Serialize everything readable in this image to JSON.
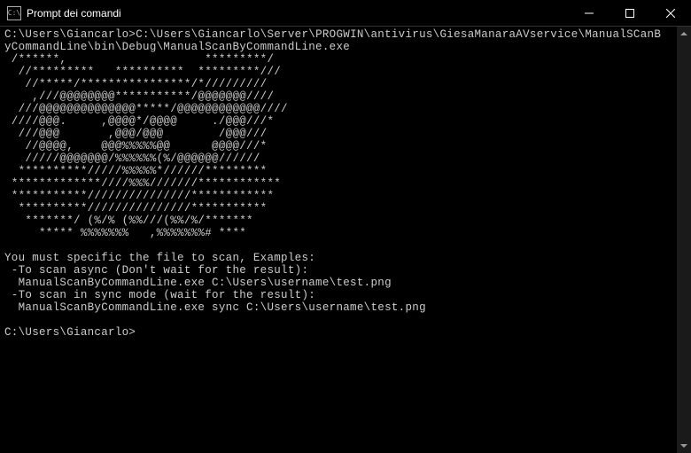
{
  "titlebar": {
    "icon_text": "C:\\",
    "title": "Prompt dei comandi"
  },
  "terminal": {
    "prompt1_path": "C:\\Users\\Giancarlo>",
    "command1": "C:\\Users\\Giancarlo\\Server\\PROGWIN\\antivirus\\GiesaManaraAVservice\\ManualSCanB",
    "command1_line2": "yCommandLine\\bin\\Debug\\ManualScanByCommandLine.exe",
    "ascii_art": " /******,                    *********/\n  //*********   **********  *********///\n   //*****/****************/*/////////\n    ,///@@@@@@@@***********/@@@@@@@////\n  ///@@@@@@@@@@@@@@*****/@@@@@@@@@@@@////\n ////@@@.     ,@@@@*/@@@@     ./@@@///*\n  ///@@@       ,@@@/@@@        /@@@///\n   //@@@@,    @@@%%%%%@@      @@@@///*\n   /////@@@@@@@/%%%%%%(%/@@@@@@//////\n  **********/////%%%%%*//////*********\n *************////%%%///////************\n ***********///////////////************\n  **********///////////////***********\n   *******/ (%/% (%%///(%%/%/*******\n     ***** %%%%%%%   ,%%%%%%%# ****",
    "usage_text": "You must specific the file to scan, Examples:\n -To scan async (Don't wait for the result):\n  ManualScanByCommandLine.exe C:\\Users\\username\\test.png\n -To scan in sync mode (wait for the result):\n  ManualScanByCommandLine.exe sync C:\\Users\\username\\test.png",
    "prompt2": "C:\\Users\\Giancarlo>"
  }
}
